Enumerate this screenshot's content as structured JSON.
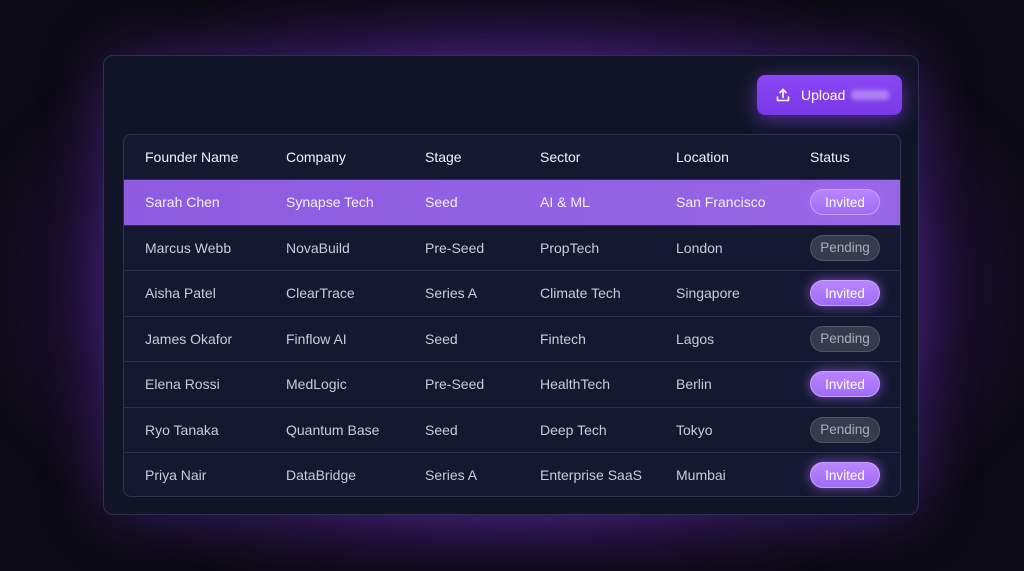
{
  "upload_button": {
    "label": "Upload",
    "icon": "upload-icon"
  },
  "table": {
    "columns": [
      "Founder Name",
      "Company",
      "Stage",
      "Sector",
      "Location",
      "Status"
    ],
    "rows": [
      [
        "Sarah Chen",
        "Synapse Tech",
        "Seed",
        "AI & ML",
        "San Francisco",
        "Invited"
      ],
      [
        "Marcus Webb",
        "NovaBuild",
        "Pre-Seed",
        "PropTech",
        "London",
        "Pending"
      ],
      [
        "Aisha Patel",
        "ClearTrace",
        "Series A",
        "Climate Tech",
        "Singapore",
        "Invited"
      ],
      [
        "James Okafor",
        "Finflow AI",
        "Seed",
        "Fintech",
        "Lagos",
        "Pending"
      ],
      [
        "Elena Rossi",
        "MedLogic",
        "Pre-Seed",
        "HealthTech",
        "Berlin",
        "Invited"
      ],
      [
        "Ryo Tanaka",
        "Quantum Base",
        "Seed",
        "Deep Tech",
        "Tokyo",
        "Pending"
      ],
      [
        "Priya Nair",
        "DataBridge",
        "Series A",
        "Enterprise SaaS",
        "Mumbai",
        "Invited"
      ]
    ],
    "selected_row": 0
  },
  "colors": {
    "accent": "#8b47f5",
    "selected_row": "#9360e3",
    "invited_badge": "#a96ff7",
    "pending_badge": "#363a4d",
    "card_bg": "#121528",
    "page_bg": "#0c0a14"
  }
}
